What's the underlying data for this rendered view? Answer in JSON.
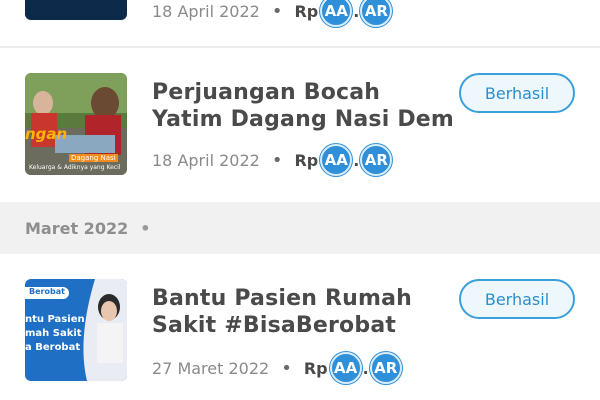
{
  "items": [
    {
      "date": "18 April 2022",
      "currency": "Rp",
      "amount_marks": [
        "AA",
        "AR"
      ]
    },
    {
      "title_line1": "Perjuangan Bocah",
      "title_line2": "Yatim Dagang Nasi Demi",
      "date": "18 April 2022",
      "currency": "Rp",
      "amount_marks": [
        "AA",
        "AR"
      ],
      "status": "Berhasil",
      "thumb_caption_main": "ngan",
      "thumb_caption_1": "Dagang Nasi",
      "thumb_caption_2": "Keluarga & Adiknya yang Kecil"
    },
    {
      "title_line1": "Bantu Pasien Rumah",
      "title_line2": "Sakit #BisaBerobat",
      "date": "27 Maret 2022",
      "currency": "Rp",
      "amount_marks": [
        "AA",
        "AR"
      ],
      "status": "Berhasil",
      "thumb_tag": "Berobat",
      "thumb_text_1": "ntu Pasien",
      "thumb_text_2": "mah Sakit",
      "thumb_text_3": "a Berobat"
    }
  ],
  "month_header": {
    "label": "Maret 2022",
    "dot": "•"
  },
  "separator_dot": "•",
  "amount_separator": ".",
  "colors": {
    "accent": "#3aa0db",
    "coin": "#2f8fd8",
    "section_bg": "#f1f1f1"
  }
}
